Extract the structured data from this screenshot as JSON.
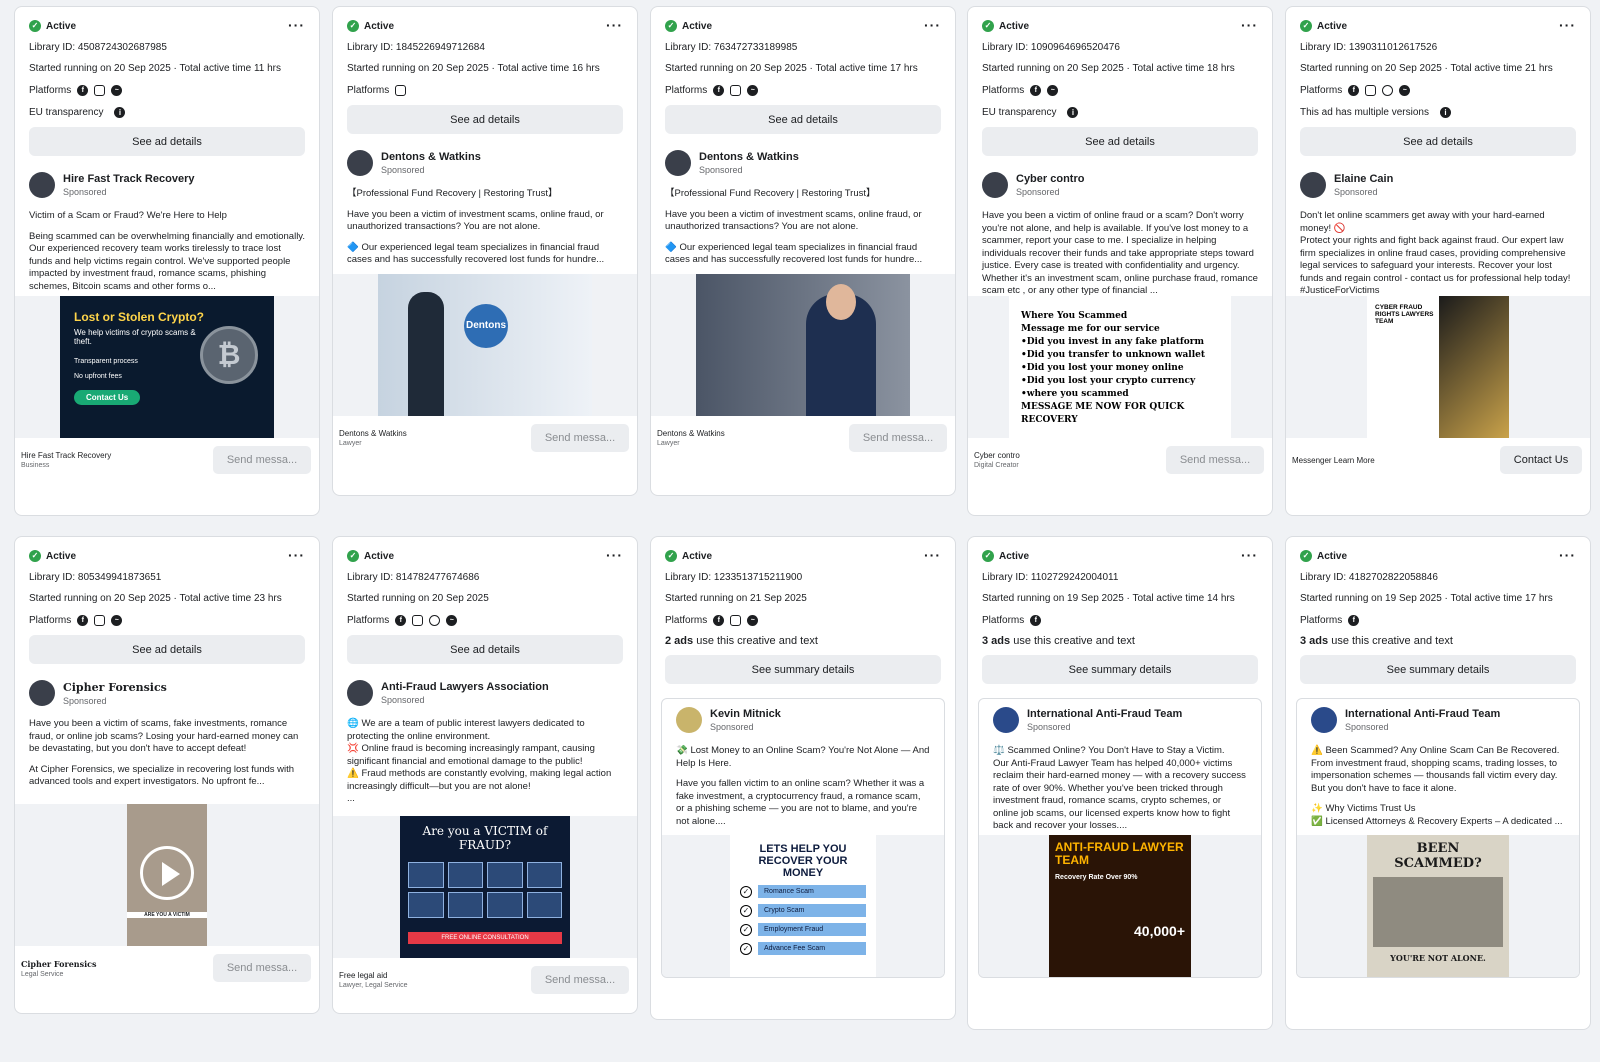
{
  "labels": {
    "active": "Active",
    "library_prefix": "Library ID: ",
    "platforms": "Platforms",
    "sponsored": "Sponsored",
    "see_ad_details": "See ad details",
    "see_summary_details": "See summary details",
    "use_creative_suffix": " use this creative and text"
  },
  "cards": [
    {
      "library_id": "Library ID: 4508724302687985",
      "started": "Started running on 20 Sep 2025 · Total active time 11 hrs",
      "platform_icons": [
        "facebook-icon",
        "instagram-icon",
        "messenger-icon"
      ],
      "extra_label": "EU transparency",
      "button": "See ad details",
      "advertiser": "Hire Fast Track Recovery",
      "body": [
        "Victim of a Scam or Fraud? We're Here to Help",
        "Being scammed can be overwhelming  financially and emotionally. Our experienced recovery team works tirelessly to trace lost funds and help victims regain control. We've supported people impacted by investment fraud, romance scams, phishing schemes, Bitcoin scams and other forms o..."
      ],
      "image_title": "Lost or Stolen Crypto?",
      "image_sub": "We help victims of crypto scams & theft.",
      "image_b1": "Transparent process",
      "image_b2": "No upfront fees",
      "image_cta": "Contact Us",
      "footer_name": "Hire Fast Track Recovery",
      "footer_cat": "Business",
      "cta": "Send messa..."
    },
    {
      "library_id": "Library ID: 1845226949712684",
      "started": "Started running on 20 Sep 2025 · Total active time 16 hrs",
      "platform_icons": [
        "instagram-icon"
      ],
      "button": "See ad details",
      "advertiser": "Dentons & Watkins",
      "body": [
        "【Professional Fund Recovery | Restoring Trust】",
        "Have you been a victim of investment scams, online fraud, or unauthorized transactions? You are not alone.",
        "🔷 Our experienced legal team specializes in financial fraud cases and has successfully recovered lost funds for hundre..."
      ],
      "image_logo": "Dentons",
      "footer_name": "Dentons & Watkins",
      "footer_cat": "Lawyer",
      "cta": "Send messa..."
    },
    {
      "library_id": "Library ID: 763472733189985",
      "started": "Started running on 20 Sep 2025 · Total active time 17 hrs",
      "platform_icons": [
        "facebook-icon",
        "instagram-icon",
        "messenger-icon"
      ],
      "button": "See ad details",
      "advertiser": "Dentons & Watkins",
      "body": [
        "【Professional Fund Recovery | Restoring Trust】",
        "Have you been a victim of investment scams, online fraud, or unauthorized transactions? You are not alone.",
        "🔷 Our experienced legal team specializes in financial fraud cases and has successfully recovered lost funds for hundre..."
      ],
      "footer_name": "Dentons & Watkins",
      "footer_cat": "Lawyer",
      "cta": "Send messa..."
    },
    {
      "library_id": "Library ID: 1090964696520476",
      "started": "Started running on 20 Sep 2025 · Total active time 18 hrs",
      "platform_icons": [
        "facebook-icon",
        "messenger-icon"
      ],
      "extra_label": "EU transparency",
      "button": "See ad details",
      "advertiser": "Cyber contro",
      "body": [
        "Have you been a victim of online fraud or a scam? Don't worry you're not alone, and help is available. If you've lost money to a scammer, report your case to me. I specialize in helping individuals recover their funds and take appropriate steps toward justice. Every case is treated with confidentiality and urgency. Whether it's an investment scam, online purchase fraud, romance scam etc , or any other type of financial ..."
      ],
      "image_lines": [
        "Where You Scammed",
        "Message me for our service",
        "•Did you invest in any fake platform",
        "•Did you transfer to unknown wallet",
        "•Did you lost your money online",
        "•Did you lost your crypto currency",
        "•where you scammed",
        "MESSAGE ME NOW FOR QUICK RECOVERY"
      ],
      "footer_name": "Cyber contro",
      "footer_cat": "Digital Creator",
      "cta": "Send messa..."
    },
    {
      "library_id": "Library ID: 1390311012617526",
      "started": "Started running on 20 Sep 2025 · Total active time 21 hrs",
      "platform_icons": [
        "facebook-icon",
        "instagram-icon",
        "threads-icon",
        "messenger-icon"
      ],
      "extra_label": "This ad has multiple versions",
      "button": "See ad details",
      "advertiser": "Elaine Cain",
      "body": [
        "Don't let online scammers get away with your hard-earned money! 🚫",
        "Protect your rights and fight back against fraud. Our expert law firm specializes in online fraud cases, providing comprehensive legal services to safeguard your interests. Recover your lost funds and regain control - contact us for professional help today! #JusticeForVictims"
      ],
      "image_title": "CYBER FRAUD RIGHTS LAWYERS TEAM",
      "footer_name": "Messenger Learn More",
      "cta": "Contact Us"
    },
    {
      "library_id": "Library ID: 805349941873651",
      "started": "Started running on 20 Sep 2025 · Total active time 23 hrs",
      "platform_icons": [
        "facebook-icon",
        "instagram-icon",
        "messenger-icon"
      ],
      "button": "See ad details",
      "advertiser": "Cipher Forensics",
      "body": [
        "Have you been a victim of scams, fake investments, romance fraud, or online job scams? Losing your hard-earned money can be devastating, but you don't have to accept defeat!",
        "At Cipher Forensics, we specialize in recovering lost funds with advanced tools and expert investigators. No upfront fe..."
      ],
      "image_caption": "ARE YOU A VICTIM",
      "footer_name": "Cipher Forensics",
      "footer_cat": "Legal Service",
      "cta": "Send messa..."
    },
    {
      "library_id": "Library ID: 814782477674686",
      "started": "Started running on 20 Sep 2025",
      "platform_icons": [
        "facebook-icon",
        "instagram-icon",
        "threads-icon",
        "messenger-icon"
      ],
      "button": "See ad details",
      "advertiser": "Anti-Fraud Lawyers Association",
      "body": [
        "🌐 We are a team of public interest lawyers dedicated to protecting the online environment.",
        "💢 Online fraud is becoming increasingly rampant, causing significant financial and emotional damage to the public!",
        "⚠️ Fraud methods are constantly evolving, making legal action increasingly difficult—but you are not alone!",
        "..."
      ],
      "image_title": "Are you a VICTIM of FRAUD?",
      "image_cta": "FREE ONLINE CONSULTATION",
      "footer_name": "Free legal aid",
      "footer_cat": "Lawyer, Legal Service",
      "cta": "Send messa..."
    },
    {
      "library_id": "Library ID: 1233513715211900",
      "started": "Started running on 21 Sep 2025",
      "platform_icons": [
        "facebook-icon",
        "instagram-icon",
        "messenger-icon"
      ],
      "ads_count": "2 ads",
      "button": "See summary details",
      "advertiser": "Kevin Mitnick",
      "body": [
        "💸 Lost Money to an Online Scam? You're Not Alone — And Help Is Here.",
        "Have you fallen victim to an online scam? Whether it was a fake investment, a cryptocurrency fraud, a romance scam, or a phishing scheme — you are not to blame, and you're not alone...."
      ],
      "image_title": "LETS HELP YOU RECOVER YOUR MONEY",
      "image_items": [
        "Romance Scam",
        "Crypto Scam",
        "Employment Fraud",
        "Advance Fee Scam"
      ]
    },
    {
      "library_id": "Library ID: 1102729242004011",
      "started": "Started running on 19 Sep 2025 · Total active time 14 hrs",
      "platform_icons": [
        "facebook-icon"
      ],
      "ads_count": "3 ads",
      "button": "See summary details",
      "advertiser": "International Anti-Fraud Team",
      "body": [
        "⚖️ Scammed Online? You Don't Have to Stay a Victim.",
        "Our Anti-Fraud Lawyer Team has helped 40,000+ victims reclaim their hard-earned money — with a recovery success rate of over 90%. Whether you've been tricked through investment fraud, romance scams, crypto schemes, or online job scams, our licensed experts know how to fight back and recover your losses...."
      ],
      "image_title": "ANTI-FRAUD LAWYER TEAM",
      "image_sub": "Recovery Rate Over 90%",
      "image_count": "40,000+"
    },
    {
      "library_id": "Library ID: 4182702822058846",
      "started": "Started running on 19 Sep 2025 · Total active time 17 hrs",
      "platform_icons": [
        "facebook-icon"
      ],
      "ads_count": "3 ads",
      "button": "See summary details",
      "advertiser": "International Anti-Fraud Team",
      "body": [
        "⚠️ Been Scammed? Any Online Scam Can Be Recovered. From investment fraud, shopping scams, trading losses, to impersonation schemes — thousands fall victim every day. But you don't have to face it alone.",
        "✨ Why Victims Trust Us",
        "✅ Licensed Attorneys & Recovery Experts – A dedicated ..."
      ],
      "image_title": "BEEN SCAMMED?",
      "image_bottom": "YOU'RE NOT ALONE."
    }
  ]
}
